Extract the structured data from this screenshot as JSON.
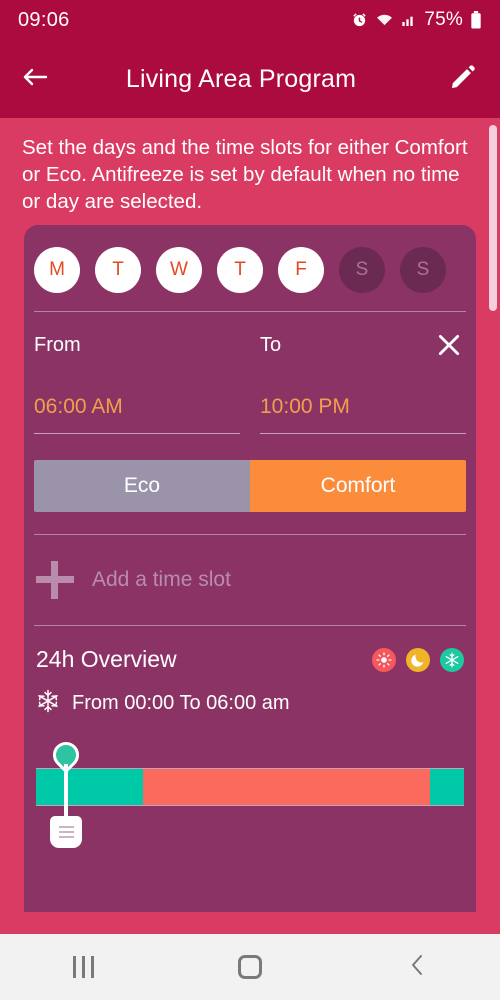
{
  "status_bar": {
    "time": "09:06",
    "battery_percent": "75%",
    "icons": [
      "alarm-icon",
      "wifi-icon",
      "signal-icon",
      "battery-icon"
    ]
  },
  "app_bar": {
    "back_icon": "arrow-left-icon",
    "title": "Living Area Program",
    "edit_icon": "pencil-icon"
  },
  "description": "Set the days and the time slots for either Comfort or Eco. Antifreeze is set by default when no time or day are selected.",
  "days": [
    {
      "label": "M",
      "selected": true
    },
    {
      "label": "T",
      "selected": true
    },
    {
      "label": "W",
      "selected": true
    },
    {
      "label": "T",
      "selected": true
    },
    {
      "label": "F",
      "selected": true
    },
    {
      "label": "S",
      "selected": false
    },
    {
      "label": "S",
      "selected": false
    }
  ],
  "time_slot": {
    "from_label": "From",
    "to_label": "To",
    "from_value": "06:00 AM",
    "to_value": "10:00 PM",
    "close_icon": "close-icon"
  },
  "modes": {
    "eco_label": "Eco",
    "comfort_label": "Comfort",
    "selected": "Comfort",
    "eco_color": "#9b93a9",
    "comfort_color": "#fb8c3c"
  },
  "add_slot": {
    "plus_icon": "plus-icon",
    "label": "Add a time slot"
  },
  "overview": {
    "title": "24h Overview",
    "legend": [
      {
        "name": "comfort-sun-icon",
        "glyph": "☀",
        "color": "#f4585c"
      },
      {
        "name": "eco-moon-icon",
        "glyph": "☾",
        "color": "#f0b429"
      },
      {
        "name": "antifreeze-snow-icon",
        "glyph": "❄",
        "color": "#1dc9a0"
      }
    ],
    "status_icon": "snowflake-icon",
    "status_text": "From 00:00 To 06:00 am",
    "timeline": {
      "segments": [
        {
          "mode": "Antifreeze",
          "from": "00:00",
          "to": "06:00",
          "percent": 25,
          "color": "#00c9a7"
        },
        {
          "mode": "Comfort",
          "from": "06:00",
          "to": "22:00",
          "percent": 67,
          "color": "#fc6a5d"
        },
        {
          "mode": "Antifreeze",
          "from": "22:00",
          "to": "24:00",
          "percent": 8,
          "color": "#00c9a7"
        }
      ],
      "marker_position_percent": 3,
      "marker_icon": "timeline-marker-pin"
    }
  },
  "nav_bar": {
    "recent_icon": "recent-apps-icon",
    "home_icon": "home-icon",
    "back_icon": "back-chevron-icon"
  },
  "theme": {
    "background": "#d93b63",
    "appbar": "#ac0b3f",
    "card": "#8c3366",
    "accent_orange": "#f0a04c",
    "day_on_text": "#e24a24"
  }
}
